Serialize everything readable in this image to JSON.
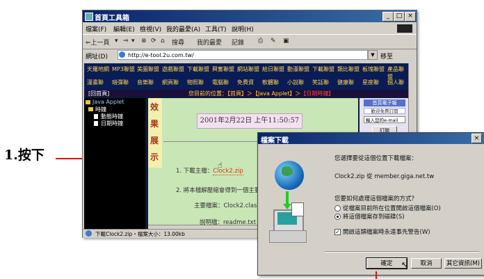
{
  "annotation": {
    "label": "1.按下"
  },
  "window": {
    "title": "首頁工具箱",
    "menu": [
      "檔案(F)",
      "編輯(E)",
      "檢視(V)",
      "我的最愛(A)",
      "工具(T)",
      "說明(H)"
    ],
    "toolbar": [
      "⇐上一頁",
      "▾",
      "⇒",
      "▾",
      "⊗",
      "⟳",
      "⌂",
      "搜尋",
      "我的最愛",
      "記錄",
      "⎙",
      "✎",
      "▣"
    ],
    "address_label": "網址(D)",
    "address_value": "http://e-tool.2u.com.tw/",
    "go_label": "移至",
    "controls": [
      "_",
      "□",
      "×"
    ]
  },
  "site": {
    "nav": [
      [
        "天羅地網",
        "MP3聯盟",
        "美圖聯盟",
        "遊戲聯盟",
        "下載聯盟",
        "興奮聯盟",
        "網站聯盟",
        "給日聯盟",
        "動漫聯盟",
        "下載聯盟",
        "類比聯盟",
        "板塊聯盟",
        "產品聯盟"
      ],
      [
        "漫畫聯",
        "暗彈聯",
        "音樂聯",
        "網頁聯",
        "物照聯",
        "電腦聯",
        "免費資",
        "軟體聯",
        "小說聯",
        "笑話聯",
        "健康聯",
        "星座聯",
        "個人聯"
      ]
    ],
    "path_left": "[回首頁]",
    "path_prefix": "您目前的位置：【首頁】＞【Java Applet】＞",
    "path_current": "【日期時鐘】",
    "tree": [
      {
        "label": "Java Applet",
        "icon": "folder-icon"
      },
      {
        "label": "時鐘",
        "icon": "folder-icon"
      },
      {
        "label": "動態時鐘",
        "icon": "doc-icon"
      },
      {
        "label": "日期時鐘",
        "icon": "doc-icon"
      }
    ],
    "vertical_title": [
      "效",
      "果",
      "展",
      "示"
    ],
    "clock_text": "2001年2月22日 上午11:50:57",
    "step1_prefix": "1. 下載主檔：",
    "step1_file": "Clock2.zip",
    "step2": "2. 將本檔解壓縮會得到一個主要",
    "main_file_label": "主要檔案：Clock2.class",
    "readme_label": "說明檔：readme.txt",
    "sidebar": {
      "head": "首頁電子報",
      "sub": "歡迎免費訂閱",
      "input_placeholder": "輸入您的e-mail",
      "button": "訂閱"
    }
  },
  "status": {
    "text": "下載Clock2.zip・檔案大小：13.00kb"
  },
  "dialog": {
    "title": "檔案下載",
    "close": "×",
    "question": "您選擇要從這個位置下載檔案：",
    "file_line": "Clock2.zip 從 member.giga.net.tw",
    "how_question": "您要如何處理這個檔案的方式？",
    "option1": "從檔案目前所在位置開啟這個檔案(O)",
    "option2": "將這個檔案存到磁碟(S)",
    "check_label": "開啟這類檔案時永遠事先警告(W)",
    "buttons": {
      "ok": "確定",
      "cancel": "取消",
      "more": "其它資訊(M)"
    }
  }
}
